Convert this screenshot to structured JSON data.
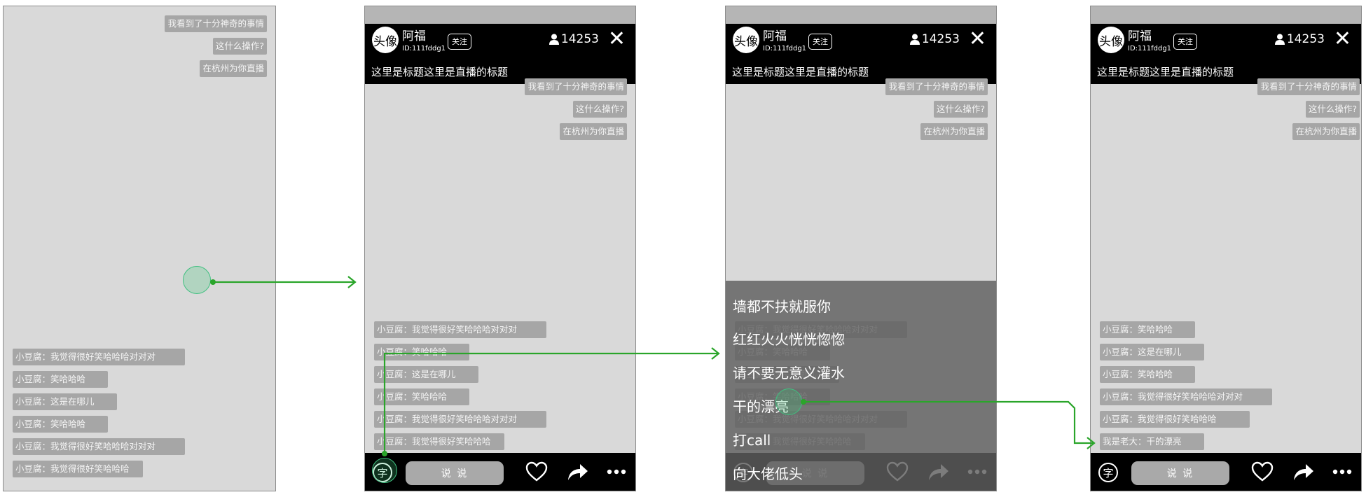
{
  "user": {
    "avatar_label": "头像",
    "name": "阿福",
    "id": "ID:111fddg1",
    "follow_label": "关注",
    "viewers": "14253"
  },
  "stream_title": "这里是标题这里是直播的标题",
  "top_messages": [
    "我看到了十分神奇的事情",
    "这什么操作?",
    "在杭州为你直播"
  ],
  "comments_panel1": [
    "小豆腐：我觉得很好笑哈哈哈对对对",
    "小豆腐：笑哈哈哈",
    "小豆腐：这是在哪儿",
    "小豆腐：笑哈哈哈",
    "小豆腐：我觉得很好笑哈哈哈对对对",
    "小豆腐：我觉得很好笑哈哈哈"
  ],
  "comments_panel2": [
    "小豆腐：我觉得很好笑哈哈哈对对对",
    "小豆腐：笑哈哈哈",
    "小豆腐：这是在哪儿",
    "小豆腐：笑哈哈哈",
    "小豆腐：我觉得很好笑哈哈哈对对对",
    "小豆腐：我觉得很好笑哈哈哈"
  ],
  "comments_panel4": [
    "小豆腐：笑哈哈哈",
    "小豆腐：这是在哪儿",
    "小豆腐：笑哈哈哈",
    "小豆腐：我觉得很好笑哈哈哈对对对",
    "小豆腐：我觉得很好笑哈哈哈",
    "我是老大：干的漂亮"
  ],
  "quick_phrases": [
    "墙都不扶就服你",
    "红红火火恍恍惚惚",
    "请不要无意义灌水",
    "干的漂亮",
    "打call",
    "向大佬低头"
  ],
  "bottom": {
    "zi_label": "字",
    "talk_label": "说 说"
  },
  "colors": {
    "arrow": "#2aa52a",
    "header": "#000000",
    "panel_bg": "#d9d9d9",
    "bubble": "#a6a6a6"
  },
  "icons": [
    "heart-icon",
    "share-icon",
    "more-icon",
    "close-icon",
    "user-icon"
  ]
}
